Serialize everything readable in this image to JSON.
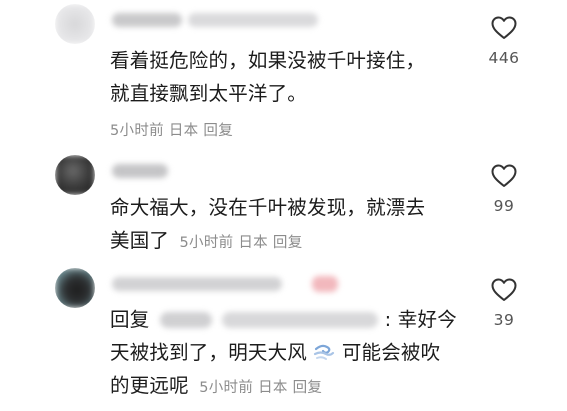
{
  "comments": [
    {
      "text_line1": "看着挺危险的，如果没被千叶接住，",
      "text_line2": "就直接飘到太平洋了。",
      "time": "5小时前",
      "location": "日本",
      "reply_label": "回复",
      "likes": "446"
    },
    {
      "text_line1": "命大福大，没在千叶被发现，就漂去",
      "text_line2": "美国了",
      "time": "5小时前",
      "location": "日本",
      "reply_label": "回复",
      "likes": "99"
    },
    {
      "reply_prefix": "回复",
      "text_line1_after": ": 幸好今",
      "text_line2_before": "天被找到了，明天大风",
      "text_line2_after": "可能会被吹",
      "text_line3": "的更远呢",
      "time": "5小时前",
      "location": "日本",
      "reply_label": "回复",
      "likes": "39",
      "emoji": "dashing-away-icon"
    }
  ],
  "colors": {
    "text": "#1c1c1c",
    "meta": "#8c8c8c",
    "like_count": "#555555",
    "heart_stroke": "#333333"
  }
}
